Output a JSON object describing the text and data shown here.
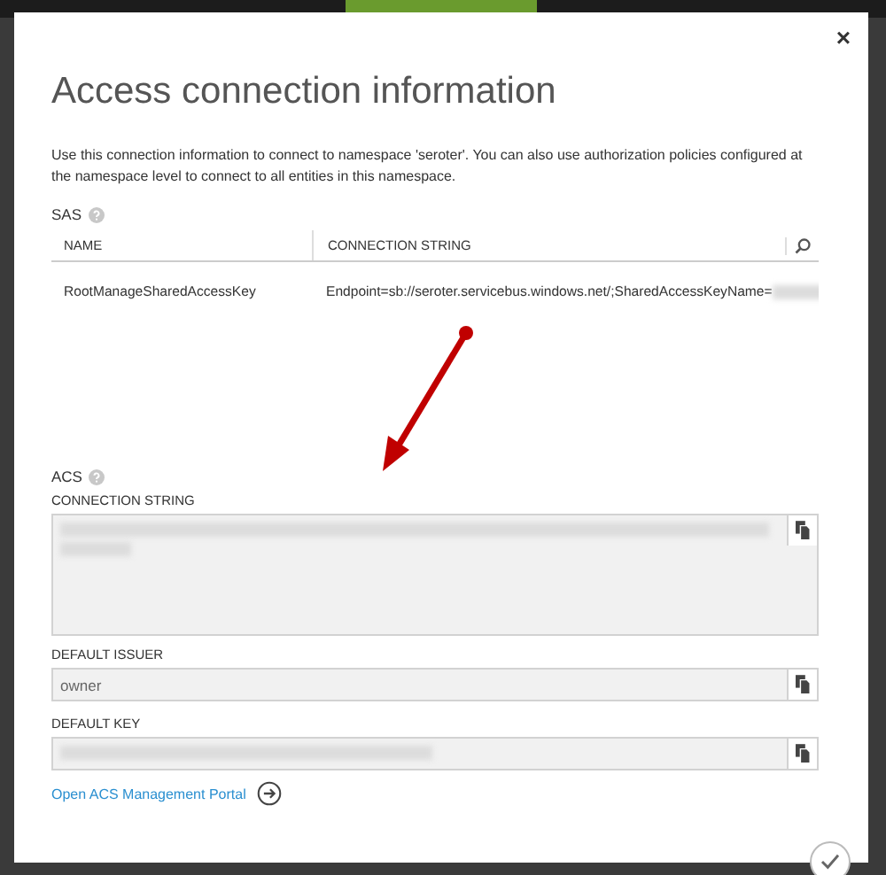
{
  "dialog": {
    "title": "Access connection information",
    "close": "×",
    "description": "Use this connection information to connect to namespace 'seroter'. You can also use authorization policies configured at the namespace level to connect to all entities in this namespace."
  },
  "sas": {
    "label": "SAS",
    "table": {
      "columns": [
        "NAME",
        "CONNECTION STRING"
      ],
      "rows": [
        {
          "name": "RootManageSharedAccessKey",
          "connection_string": "Endpoint=sb://seroter.servicebus.windows.net/;SharedAccessKeyName="
        }
      ]
    }
  },
  "acs": {
    "label": "ACS",
    "fields": [
      {
        "label": "CONNECTION STRING",
        "kind": "textarea"
      },
      {
        "label": "DEFAULT ISSUER",
        "kind": "input",
        "value": "owner"
      },
      {
        "label": "DEFAULT KEY",
        "kind": "input"
      }
    ],
    "link": "Open ACS Management Portal"
  }
}
